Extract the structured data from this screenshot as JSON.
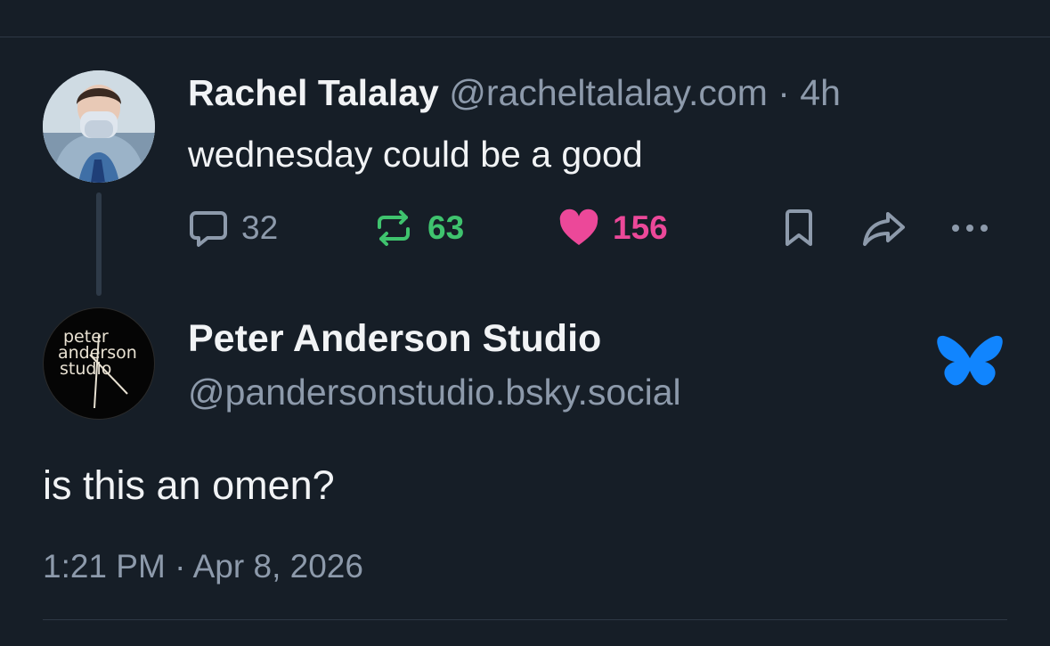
{
  "parent_post": {
    "author_name": "Rachel Talalay",
    "author_handle": "@racheltalalay.com",
    "separator": " · ",
    "time_ago": "4h",
    "text": "wednesday could be a good",
    "reply_count": "32",
    "repost_count": "63",
    "like_count": "156",
    "icons": [
      "reply-icon",
      "repost-icon",
      "like-icon",
      "bookmark-icon",
      "share-icon",
      "more-icon"
    ]
  },
  "post": {
    "author_name": "Peter Anderson Studio",
    "author_handle": "@pandersonstudio.bsky.social",
    "avatar_logo_lines": [
      "peter",
      "anderson",
      "studio"
    ],
    "text": "is this an omen?",
    "timestamp": "1:21 PM · Apr 8, 2026"
  },
  "colors": {
    "background": "#161e27",
    "muted_text": "#8d9aab",
    "repost_green": "#3fc36e",
    "like_pink": "#ec4899",
    "bluesky_blue": "#1185fe"
  }
}
